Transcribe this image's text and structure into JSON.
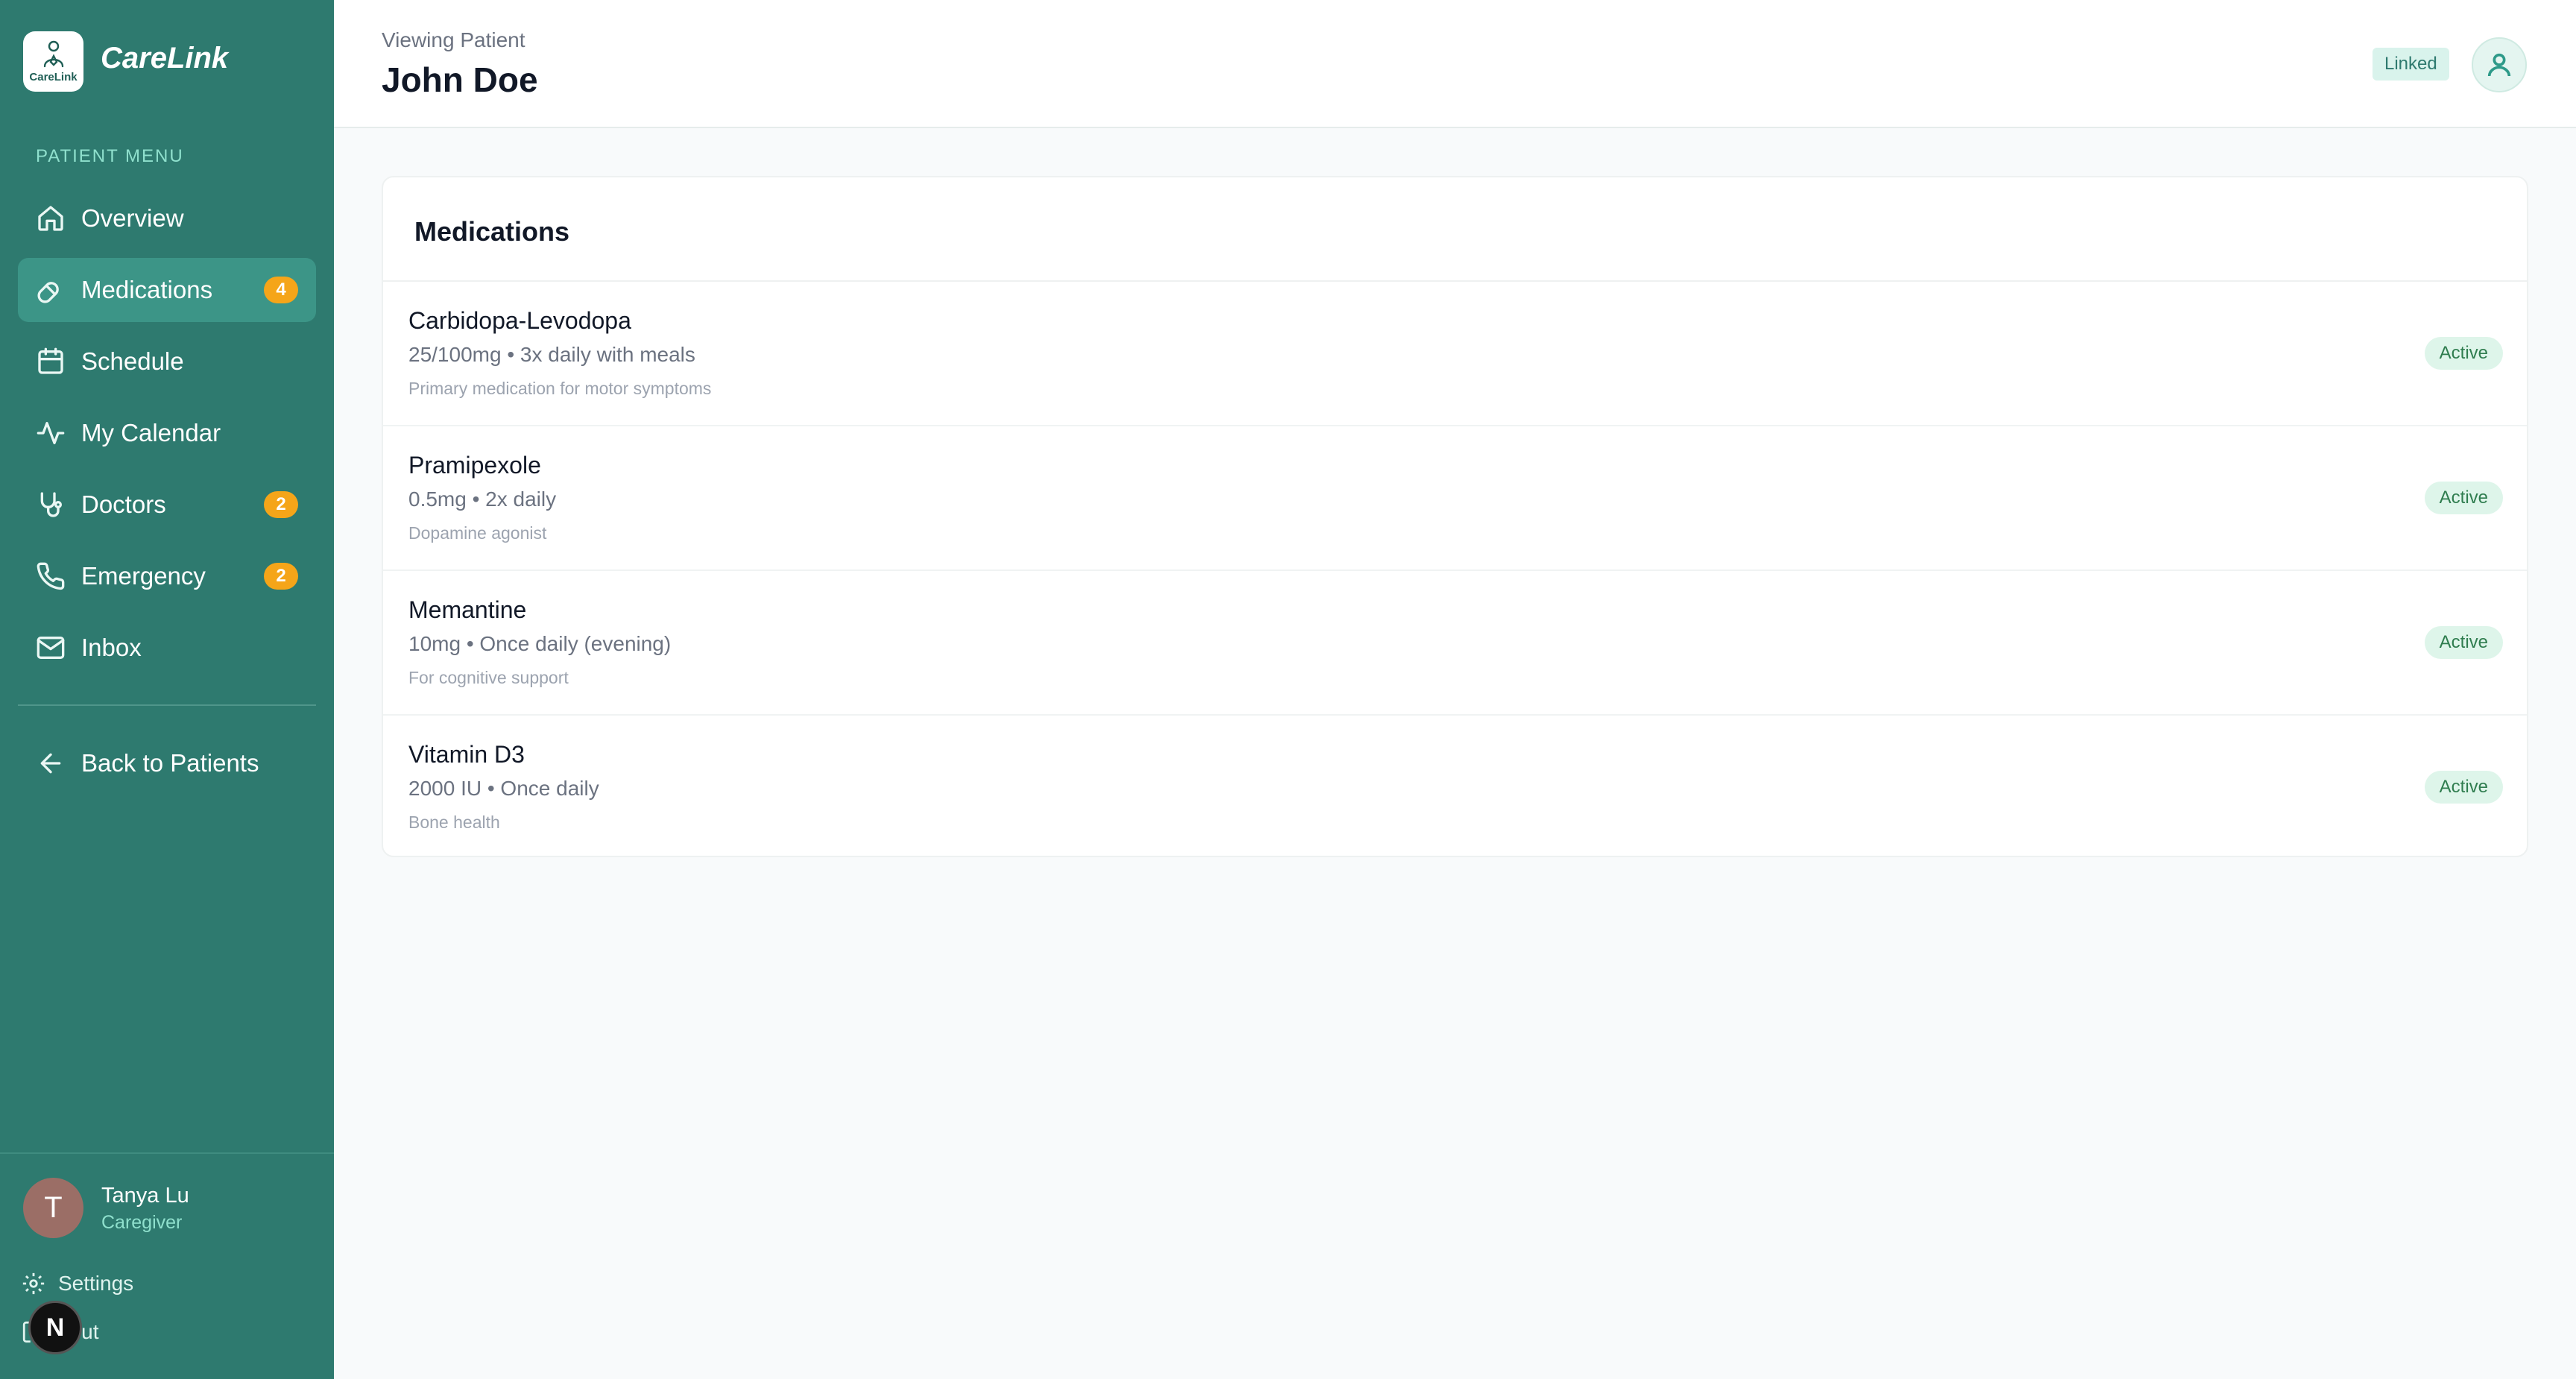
{
  "app": {
    "brand": "CareLink",
    "logo_text": "CareLink"
  },
  "sidebar": {
    "heading": "PATIENT MENU",
    "items": [
      {
        "label": "Overview",
        "icon": "home-icon"
      },
      {
        "label": "Medications",
        "icon": "pill-icon",
        "badge": "4",
        "active": true
      },
      {
        "label": "Schedule",
        "icon": "calendar-icon"
      },
      {
        "label": "My Calendar",
        "icon": "activity-icon"
      },
      {
        "label": "Doctors",
        "icon": "stethoscope-icon",
        "badge": "2"
      },
      {
        "label": "Emergency",
        "icon": "phone-icon",
        "badge": "2"
      },
      {
        "label": "Inbox",
        "icon": "mail-icon"
      }
    ],
    "back_label": "Back to Patients",
    "user": {
      "initial": "T",
      "name": "Tanya Lu",
      "role": "Caregiver"
    },
    "settings_label": "Settings",
    "logout_label": "gout",
    "overlay_letter": "N"
  },
  "header": {
    "viewing_label": "Viewing Patient",
    "patient_name": "John Doe",
    "linked_label": "Linked"
  },
  "main": {
    "card_title": "Medications",
    "medications": [
      {
        "name": "Carbidopa-Levodopa",
        "dose": "25/100mg • 3x daily with meals",
        "note": "Primary medication for motor symptoms",
        "status": "Active"
      },
      {
        "name": "Pramipexole",
        "dose": "0.5mg • 2x daily",
        "note": "Dopamine agonist",
        "status": "Active"
      },
      {
        "name": "Memantine",
        "dose": "10mg • Once daily (evening)",
        "note": "For cognitive support",
        "status": "Active"
      },
      {
        "name": "Vitamin D3",
        "dose": "2000 IU • Once daily",
        "note": "Bone health",
        "status": "Active"
      }
    ]
  },
  "colors": {
    "sidebar_bg": "#2e7a6f",
    "active_item": "#3c9587",
    "badge": "#f5a519",
    "accent_light": "#8fe0cd"
  }
}
